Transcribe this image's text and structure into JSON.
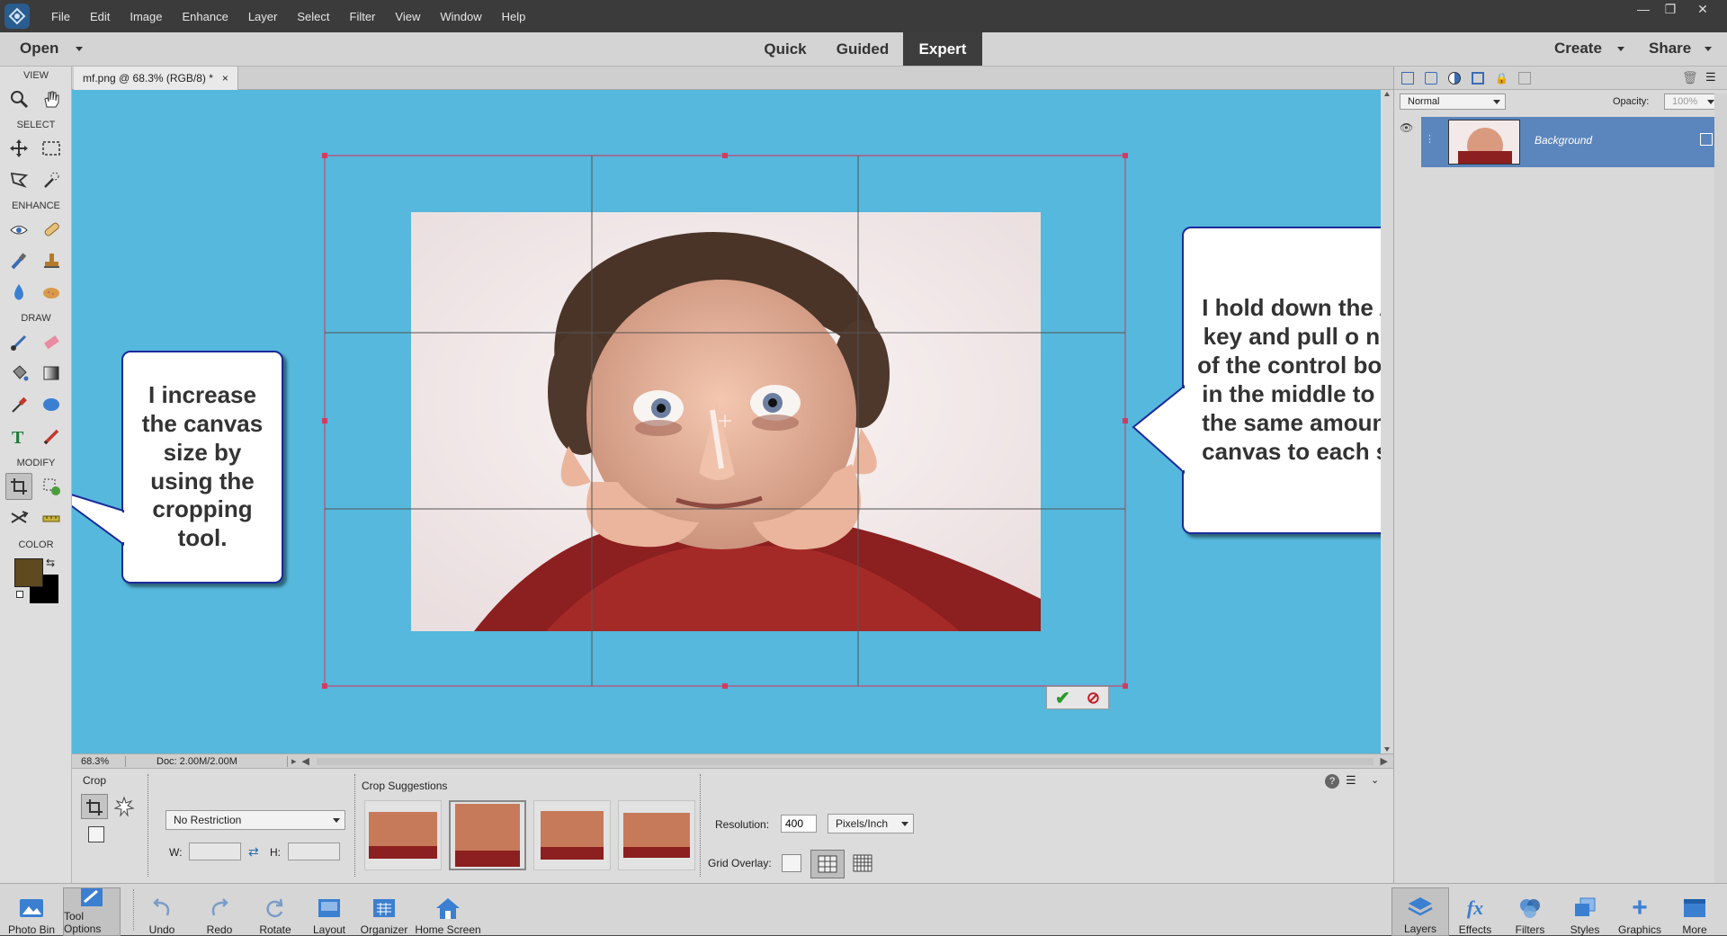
{
  "menu": [
    "File",
    "Edit",
    "Image",
    "Enhance",
    "Layer",
    "Select",
    "Filter",
    "View",
    "Window",
    "Help"
  ],
  "mode_bar": {
    "open": "Open",
    "modes": [
      "Quick",
      "Guided",
      "Expert"
    ],
    "active_mode": "Expert",
    "create": "Create",
    "share": "Share"
  },
  "toolbox": {
    "sections": {
      "view": "VIEW",
      "select": "SELECT",
      "enhance": "ENHANCE",
      "draw": "DRAW",
      "modify": "MODIFY",
      "color": "COLOR"
    },
    "foreground": "#5e4a1e",
    "background": "#000000"
  },
  "document": {
    "tab_title": "mf.png @ 68.3% (RGB/8) *",
    "close": "×"
  },
  "status": {
    "zoom": "68.3%",
    "doc": "Doc: 2.00M/2.00M"
  },
  "callouts": {
    "left": "I increase the canvas size by using the cropping tool.",
    "right": "I hold down the ALT key and pull o none of the control boixes in the middle to add the same amount of canvas to each side"
  },
  "tool_options": {
    "title": "Crop",
    "restriction": "No Restriction",
    "w_label": "W:",
    "h_label": "H:",
    "w_value": "",
    "h_value": "",
    "suggestions_label": "Crop Suggestions",
    "resolution_label": "Resolution:",
    "resolution_value": "400",
    "resolution_unit": "Pixels/Inch",
    "grid_overlay_label": "Grid Overlay:"
  },
  "layers_panel": {
    "blend_mode": "Normal",
    "opacity_label": "Opacity:",
    "opacity_value": "100%",
    "layer_name": "Background"
  },
  "bottom_left": [
    "Photo Bin",
    "Tool Options",
    "Undo",
    "Redo",
    "Rotate",
    "Layout",
    "Organizer",
    "Home Screen"
  ],
  "bottom_right": [
    "Layers",
    "Effects",
    "Filters",
    "Styles",
    "Graphics",
    "More"
  ],
  "colors": {
    "canvas": "#55b8dc",
    "crop_line": "#c8456a",
    "callout_border": "#1a2a9a",
    "panel_selection": "#5b86bd"
  }
}
